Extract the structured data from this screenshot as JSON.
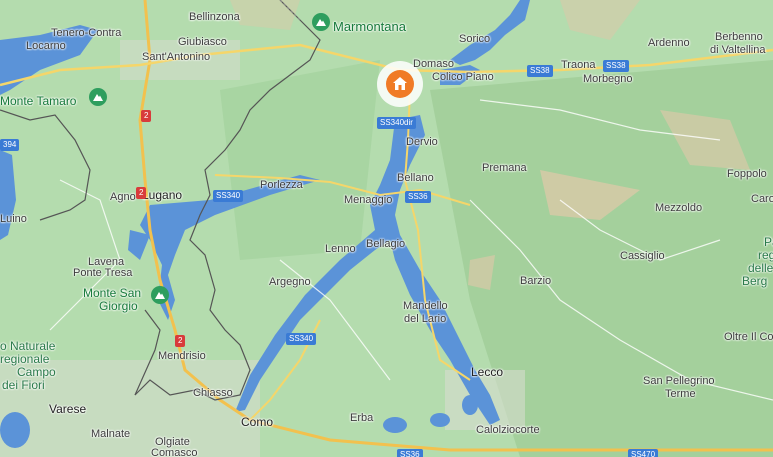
{
  "labels": {
    "bellinzona": "Bellinzona",
    "marmontana": "Marmontana",
    "tenero_contra": "Tenero-Contra",
    "giubiasco": "Giubiasco",
    "locarno": "Locarno",
    "sant_antonino": "Sant'Antonino",
    "sorico": "Sorico",
    "domaso": "Domaso",
    "colico_piano": "Colico Piano",
    "traona": "Traona",
    "ardenno": "Ardenno",
    "berbenno": "Berbenno",
    "di_valtellina": "di Valtellina",
    "morbegno": "Morbegno",
    "monte_tamaro": "Monte Tamaro",
    "dervio": "Dervio",
    "premana": "Premana",
    "bellano": "Bellano",
    "foppolo": "Foppolo",
    "porlezza": "Porlezza",
    "menaggio": "Menaggio",
    "agno": "Agno",
    "lugano": "Lugano",
    "luino": "Luino",
    "mezzoldo": "Mezzoldo",
    "caro": "Caro",
    "lenno": "Lenno",
    "bellagio": "Bellagio",
    "cassiglio": "Cassiglio",
    "lavena": "Lavena",
    "ponte_tresa": "Ponte Tresa",
    "argegno": "Argegno",
    "barzio": "Barzio",
    "monte_san": "Monte San",
    "giorgio": "Giorgio",
    "mandello": "Mandello",
    "del_lario": "del Lario",
    "mendrisio": "Mendrisio",
    "oltre_il_colle": "Oltre Il Cole",
    "campo_line1": "o Naturale",
    "campo_line2": "regionale",
    "campo_line3": "Campo",
    "campo_line4": "dei Fiori",
    "lecco": "Lecco",
    "san_pellegrino": "San Pellegrino",
    "terme": "Terme",
    "chiasso": "Chiasso",
    "varese": "Varese",
    "como": "Como",
    "erba": "Erba",
    "malnate": "Malnate",
    "olgiate": "Olgiate",
    "comasco": "Comasco",
    "calolziocorte": "Calolziocorte",
    "parco_1": "Pa",
    "parco_2": "reg",
    "parco_3": "delle",
    "parco_4": "Berg"
  },
  "shields": {
    "ss38_a": "SS38",
    "ss38_b": "SS38",
    "ss340dir": "SS340dir",
    "ss340_a": "SS340",
    "ss340_b": "SS340",
    "ss36_a": "SS36",
    "ss36_b": "SS36",
    "a2_a": "2",
    "a2_b": "2",
    "a2_c": "2",
    "r394": "394",
    "ss470": "SS470"
  },
  "markers": {
    "home_icon": "home-icon",
    "peak_icon": "mountain-icon"
  },
  "colors": {
    "land": "#a9d3a3",
    "water": "#5b93d8",
    "road_yellow": "#f5d66a",
    "highway": "#f2c14e",
    "border": "#555555",
    "home_marker": "#f07b26",
    "peak_marker": "#2e9e5e",
    "shield_blue": "#3a7bd5",
    "shield_red": "#d83b3b"
  }
}
